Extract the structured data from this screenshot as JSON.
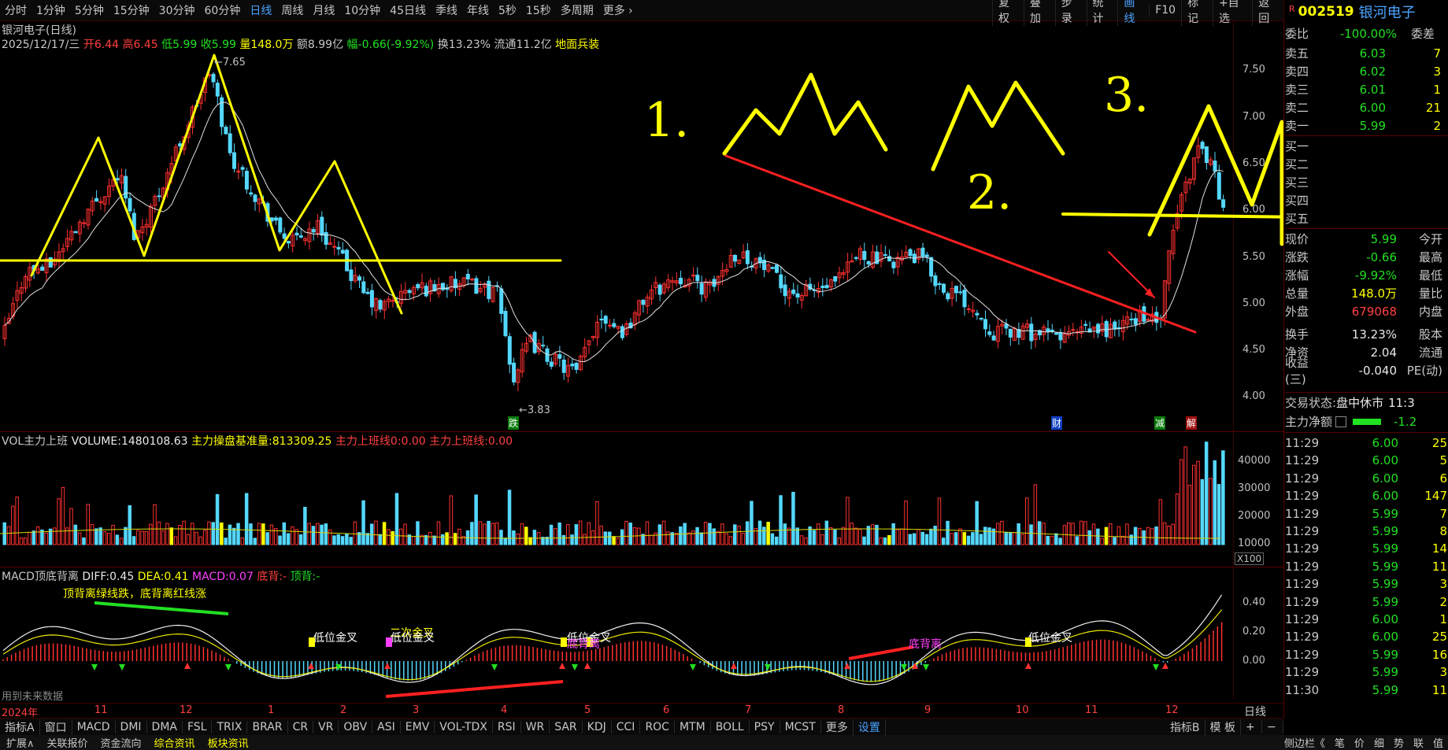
{
  "period_tabs": [
    "分时",
    "1分钟",
    "5分钟",
    "15分钟",
    "30分钟",
    "60分钟",
    "日线",
    "周线",
    "月线",
    "10分钟",
    "45日线",
    "季线",
    "年线",
    "5秒",
    "15秒",
    "多周期",
    "更多"
  ],
  "active_period": "日线",
  "top_tools": [
    "复权",
    "叠加",
    "步录",
    "统计",
    "画线",
    "F10",
    "标记",
    "+自选",
    "返回"
  ],
  "active_tool": "画线",
  "stock": {
    "code": "002519",
    "name": "银河电子",
    "flag": "R"
  },
  "chart_title": "银河电子(日线)",
  "ohlc": {
    "date": "2025/12/17/三",
    "open_label": "开",
    "open": "6.44",
    "high_label": "高",
    "high": "6.45",
    "low_label": "低",
    "low": "5.99",
    "close_label": "收",
    "close": "5.99",
    "vol_label": "量",
    "volume": "148.0万",
    "amount_label": "额",
    "amount": "8.99亿",
    "change_label": "幅",
    "change": "-0.66(-9.92%)",
    "turnover_label": "换",
    "turnover": "13.23%",
    "float_label": "流通",
    "float": "11.2亿",
    "concept": "地面兵装"
  },
  "price_axis": [
    "7.50",
    "7.00",
    "6.50",
    "6.00",
    "5.50",
    "5.00",
    "4.50",
    "4.00"
  ],
  "annotations": {
    "high": "7.65",
    "low": "3.83",
    "die": "跌",
    "cai": "财",
    "jian": "减",
    "jie": "解"
  },
  "handwriting": {
    "one": "1.",
    "two": "2.",
    "three": "3."
  },
  "vol_panel": {
    "name": "VOL主力上班",
    "volume_label": "VOLUME:",
    "volume": "1480108.63",
    "base_label": "主力操盘基准量:",
    "base": "813309.25",
    "line1_label": "主力上班线0:",
    "line1": "0.00",
    "line2_label": "主力上班线:",
    "line2": "0.00",
    "axis": [
      "40000",
      "30000",
      "20000",
      "10000"
    ],
    "unit": "X100"
  },
  "macd_panel": {
    "name": "MACD顶底背离",
    "diff_label": "DIFF:",
    "diff": "0.45",
    "dea_label": "DEA:",
    "dea": "0.41",
    "macd_label": "MACD:",
    "macd": "0.07",
    "bottom_label": "底背:",
    "bottom": "-",
    "top_label": "顶背:",
    "top": "-",
    "note": "顶背离绿线跌，底背离红线涨",
    "axis": [
      "0.40",
      "0.20",
      "0.00"
    ],
    "tags": [
      "低位金叉",
      "二次金叉",
      "低位金叉",
      "低位金叉",
      "底背离",
      "底背离",
      "低位金叉"
    ],
    "future": "用到未来数据"
  },
  "x_axis": [
    "2024年",
    "11",
    "12",
    "1",
    "2",
    "3",
    "4",
    "5",
    "6",
    "7",
    "8",
    "9",
    "10",
    "11",
    "12"
  ],
  "x_axis_right": "日线",
  "indicator_tabs": [
    "指标A",
    "窗口",
    "MACD",
    "DMI",
    "DMA",
    "FSL",
    "TRIX",
    "BRAR",
    "CR",
    "VR",
    "OBV",
    "ASI",
    "EMV",
    "VOL-TDX",
    "RSI",
    "WR",
    "SAR",
    "KDJ",
    "CCI",
    "ROC",
    "MTM",
    "BOLL",
    "PSY",
    "MCST",
    "更多",
    "设置"
  ],
  "indicator_tabs_right": [
    "指标B",
    "模 板"
  ],
  "status_tabs": [
    "扩展∧",
    "关联报价",
    "资金流向",
    "综合资讯",
    "板块资讯"
  ],
  "status_right": [
    "侧边栏《",
    "笔",
    "价",
    "细",
    "势",
    "联",
    "值"
  ],
  "order_book": {
    "weibi_label": "委比",
    "weibi": "-100.00%",
    "weicha_label": "委差",
    "weicha": "-",
    "asks": [
      {
        "label": "卖五",
        "price": "6.03",
        "qty": "7"
      },
      {
        "label": "卖四",
        "price": "6.02",
        "qty": "3"
      },
      {
        "label": "卖三",
        "price": "6.01",
        "qty": "1"
      },
      {
        "label": "卖二",
        "price": "6.00",
        "qty": "21"
      },
      {
        "label": "卖一",
        "price": "5.99",
        "qty": "2"
      }
    ],
    "bids": [
      {
        "label": "买一",
        "price": "",
        "qty": ""
      },
      {
        "label": "买二",
        "price": "",
        "qty": ""
      },
      {
        "label": "买三",
        "price": "",
        "qty": ""
      },
      {
        "label": "买四",
        "price": "",
        "qty": ""
      },
      {
        "label": "买五",
        "price": "",
        "qty": ""
      }
    ]
  },
  "quote": [
    {
      "k": "现价",
      "v": "5.99",
      "k2": "今开",
      "c": "green"
    },
    {
      "k": "涨跌",
      "v": "-0.66",
      "k2": "最高",
      "c": "green"
    },
    {
      "k": "涨幅",
      "v": "-9.92%",
      "k2": "最低",
      "c": "green"
    },
    {
      "k": "总量",
      "v": "148.0万",
      "k2": "量比",
      "c": "yellow"
    },
    {
      "k": "外盘",
      "v": "679068",
      "k2": "内盘",
      "c": "red"
    },
    {
      "k": "换手",
      "v": "13.23%",
      "k2": "股本",
      "c": "white"
    },
    {
      "k": "净资",
      "v": "2.04",
      "k2": "流通",
      "c": "white"
    },
    {
      "k": "收益(三)",
      "v": "-0.040",
      "k2": "PE(动)",
      "c": "white"
    }
  ],
  "trade_status_label": "交易状态:",
  "trade_status": "盘中休市",
  "trade_time": "11:3",
  "net_label": "主力净额",
  "net_value": "-1.2",
  "ticks": [
    {
      "t": "11:29",
      "p": "6.00",
      "n": "25",
      "c": "green"
    },
    {
      "t": "11:29",
      "p": "6.00",
      "n": "5",
      "c": "green"
    },
    {
      "t": "11:29",
      "p": "6.00",
      "n": "6",
      "c": "green"
    },
    {
      "t": "11:29",
      "p": "6.00",
      "n": "147",
      "c": "green"
    },
    {
      "t": "11:29",
      "p": "5.99",
      "n": "7",
      "c": "green"
    },
    {
      "t": "11:29",
      "p": "5.99",
      "n": "8",
      "c": "green"
    },
    {
      "t": "11:29",
      "p": "5.99",
      "n": "14",
      "c": "green"
    },
    {
      "t": "11:29",
      "p": "5.99",
      "n": "11",
      "c": "green"
    },
    {
      "t": "11:29",
      "p": "5.99",
      "n": "3",
      "c": "green"
    },
    {
      "t": "11:29",
      "p": "5.99",
      "n": "2",
      "c": "green"
    },
    {
      "t": "11:29",
      "p": "6.00",
      "n": "1",
      "c": "green"
    },
    {
      "t": "11:29",
      "p": "6.00",
      "n": "25",
      "c": "green"
    },
    {
      "t": "11:29",
      "p": "5.99",
      "n": "16",
      "c": "green"
    },
    {
      "t": "11:29",
      "p": "5.99",
      "n": "3",
      "c": "green"
    },
    {
      "t": "11:30",
      "p": "5.99",
      "n": "11",
      "c": "green"
    }
  ]
}
